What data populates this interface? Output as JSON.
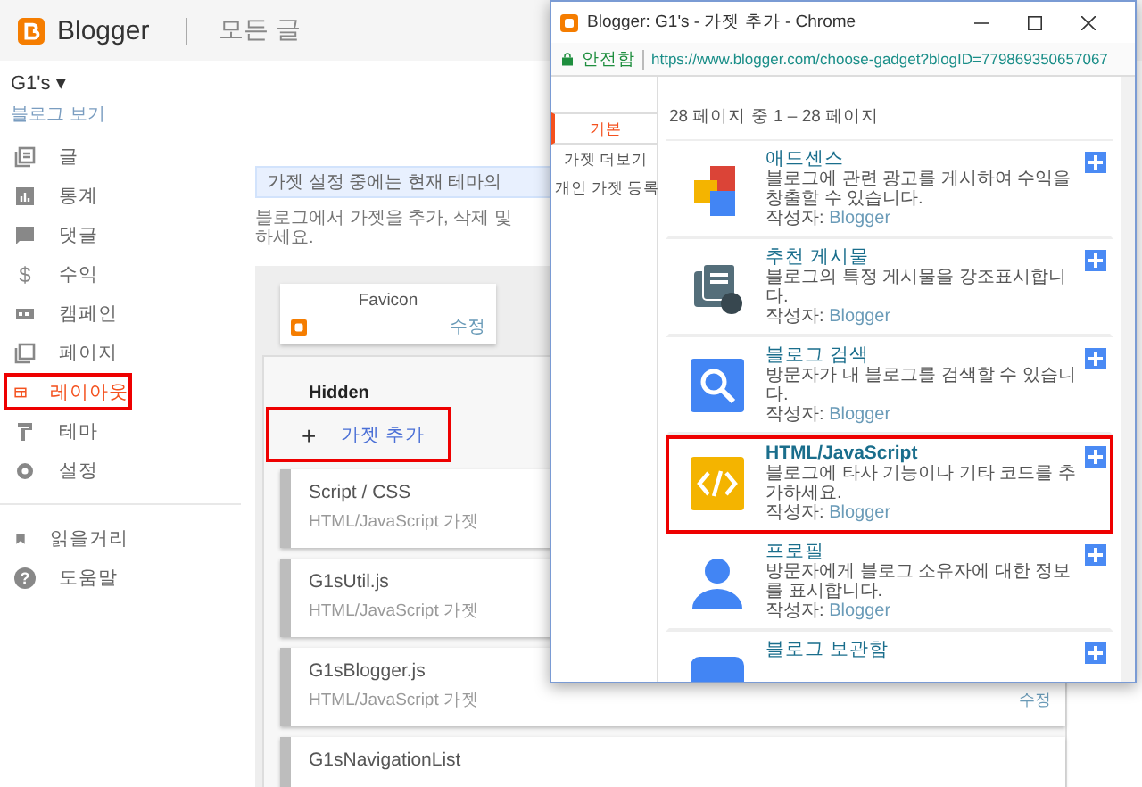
{
  "header": {
    "app_name": "Blogger",
    "page_title": "모든 글"
  },
  "sidebar": {
    "blog_name": "G1's",
    "blog_caret": "▾",
    "view_blog": "블로그 보기",
    "items": [
      {
        "label": "글",
        "selected": false,
        "annotated": false
      },
      {
        "label": "통계",
        "selected": false,
        "annotated": false
      },
      {
        "label": "댓글",
        "selected": false,
        "annotated": false
      },
      {
        "label": "수익",
        "glyph": "$",
        "selected": false,
        "annotated": false
      },
      {
        "label": "캠페인",
        "selected": false,
        "annotated": false
      },
      {
        "label": "페이지",
        "selected": false,
        "annotated": false
      },
      {
        "label": "레이아웃",
        "selected": true,
        "annotated": true
      },
      {
        "label": "테마",
        "selected": false,
        "annotated": false
      },
      {
        "label": "설정",
        "selected": false,
        "annotated": false
      }
    ],
    "secondary_items": [
      {
        "label": "읽을거리"
      },
      {
        "label": "도움말",
        "glyph": "?"
      }
    ]
  },
  "main": {
    "notice": "가젯 설정 중에는 현재 테마의",
    "description_lines": [
      "블로그에서 가젯을 추가, 삭제 및",
      "하세요."
    ],
    "favicon": {
      "title": "Favicon",
      "edit": "수정"
    },
    "section": {
      "title": "Hidden",
      "add_icon": "+",
      "add_gadget": "가젯 추가",
      "annotated": true
    },
    "gadgets": [
      {
        "name": "Script / CSS",
        "type": "HTML/JavaScript 가젯"
      },
      {
        "name": "G1sUtil.js",
        "type": "HTML/JavaScript 가젯"
      },
      {
        "name": "G1sBlogger.js",
        "type": "HTML/JavaScript 가젯",
        "edit": "수정"
      },
      {
        "name": "G1sNavigationList"
      }
    ]
  },
  "popup": {
    "title": "Blogger: G1's - 가젯 추가 - Chrome",
    "secure": "안전함",
    "url": "https://www.blogger.com/choose-gadget?blogID=779869350657067",
    "tabs": [
      {
        "label": "기본",
        "selected": true
      },
      {
        "label": "가젯 더보기",
        "selected": false
      },
      {
        "label": "개인 가젯 등록",
        "selected": false
      }
    ],
    "page_info": "28 페이지 중 1 – 28 페이지",
    "gadgets": [
      {
        "title": "애드센스",
        "description": "블로그에 관련 광고를 게시하여 수익을 창출할 수 있습니다.",
        "author_label": "작성자:",
        "author": "Blogger",
        "annotated": false
      },
      {
        "title": "추천 게시물",
        "description": "블로그의 특정 게시물을 강조표시합니다.",
        "author_label": "작성자:",
        "author": "Blogger",
        "annotated": false
      },
      {
        "title": "블로그 검색",
        "description": "방문자가 내 블로그를 검색할 수 있습니다.",
        "author_label": "작성자:",
        "author": "Blogger",
        "annotated": false
      },
      {
        "title": "HTML/JavaScript",
        "description": "블로그에 타사 기능이나 기타 코드를 추가하세요.",
        "author_label": "작성자:",
        "author": "Blogger",
        "annotated": true
      },
      {
        "title": "프로필",
        "description": "방문자에게 블로그 소유자에 대한 정보를 표시합니다.",
        "author_label": "작성자:",
        "author": "Blogger",
        "annotated": false
      },
      {
        "title": "블로그 보관함"
      }
    ]
  }
}
